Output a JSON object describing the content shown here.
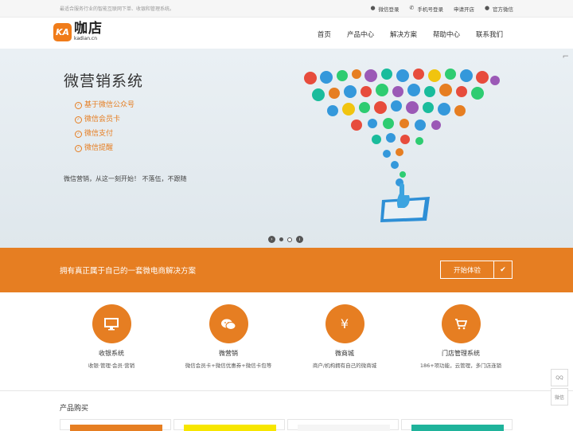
{
  "topbar": {
    "slogan": "最适合服务行业的智能互联网下单、收银和管理系统。",
    "links": [
      {
        "label": "微信登录",
        "icon": "wechat-icon"
      },
      {
        "label": "手机号登录",
        "icon": "phone-icon"
      },
      {
        "label": "申请开店",
        "icon": ""
      },
      {
        "label": "官方微信",
        "icon": "wechat-icon"
      }
    ]
  },
  "header": {
    "logo_badge": "KA",
    "logo_cn": "咖店",
    "logo_en": "kadian.cn",
    "nav": [
      "首页",
      "产品中心",
      "解决方案",
      "帮助中心",
      "联系我们"
    ]
  },
  "hero": {
    "title": "微营销系统",
    "features": [
      "基于微信公众号",
      "微信会员卡",
      "微信支付",
      "微信提醒"
    ],
    "description": "微信营销，从这一刻开始！ 不落伍，不跟随"
  },
  "band": {
    "text": "拥有真正属于自己的一套微电商解决方案",
    "button_label": "开始体验"
  },
  "features": [
    {
      "title": "收银系统",
      "desc": "收银·管理·会员·营销",
      "icon": "monitor-icon"
    },
    {
      "title": "微营销",
      "desc": "微信会员卡+微信优惠券+微信卡包等",
      "icon": "wechat-icon"
    },
    {
      "title": "微商城",
      "desc": "商户/机构拥有自己的微商城",
      "icon": "yen-icon"
    },
    {
      "title": "门店管理系统",
      "desc": "186+项功能，云管理，多门店连锁",
      "icon": "cart-icon"
    }
  ],
  "products": {
    "title": "产品购买"
  },
  "side": {
    "qq": "QQ",
    "wechat": "微信"
  },
  "colors": {
    "accent": "#e67e22",
    "brand": "#f07c1a"
  }
}
